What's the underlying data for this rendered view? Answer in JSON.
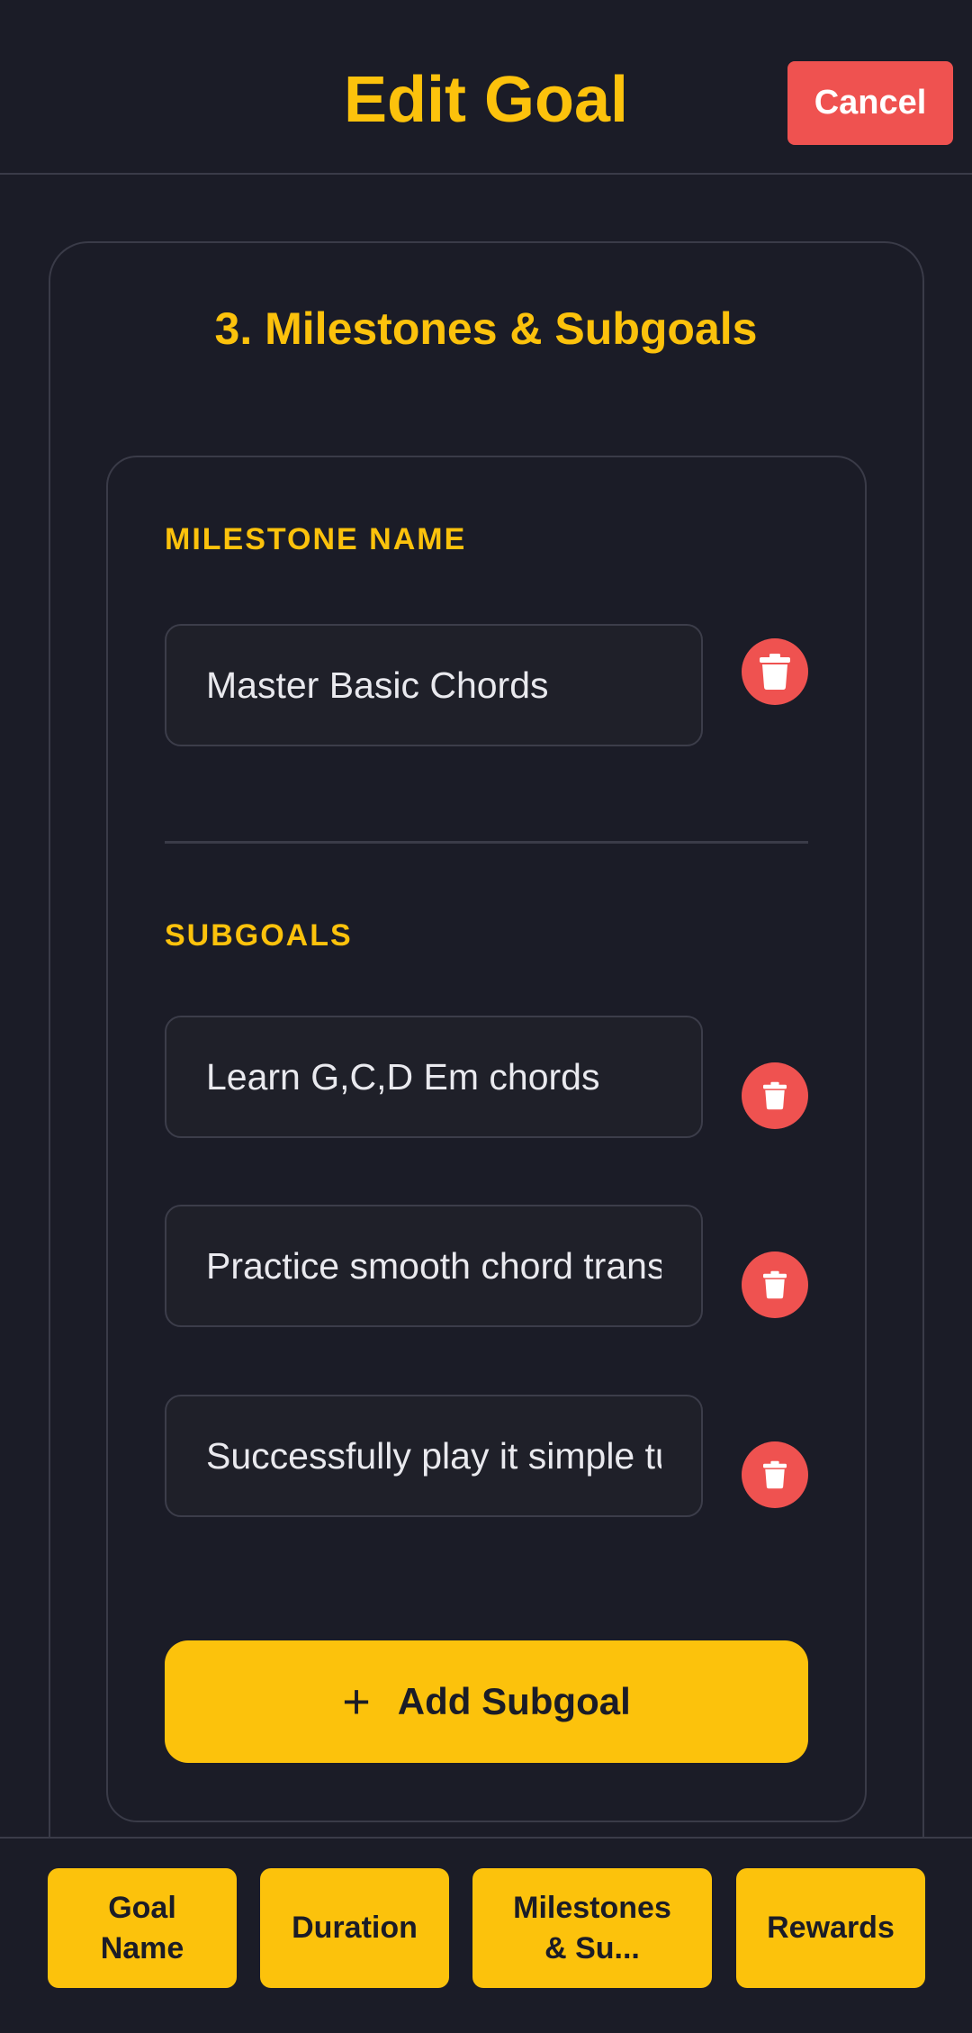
{
  "header": {
    "title": "Edit Goal",
    "cancel_label": "Cancel"
  },
  "section": {
    "title": "3. Milestones & Subgoals"
  },
  "milestone": {
    "name_label": "MILESTONE NAME",
    "name_value": "Master Basic Chords",
    "delete_icon": "trash-icon"
  },
  "subgoals": {
    "label": "SUBGOALS",
    "items": [
      {
        "value": "Learn G,C,D Em chords"
      },
      {
        "value": "Practice smooth chord transitions"
      },
      {
        "value": "Successfully play it simple tunes"
      }
    ]
  },
  "add_subgoal": {
    "icon": "plus-icon",
    "label": "Add Subgoal"
  },
  "bottom_tabs": [
    {
      "label": "Goal\nName"
    },
    {
      "label": "Duration"
    },
    {
      "label": "Milestones\n& Su..."
    },
    {
      "label": "Rewards"
    }
  ],
  "colors": {
    "background": "#1b1c27",
    "accent": "#fcc20c",
    "danger": "#ef5250",
    "border": "#3a3b48"
  }
}
